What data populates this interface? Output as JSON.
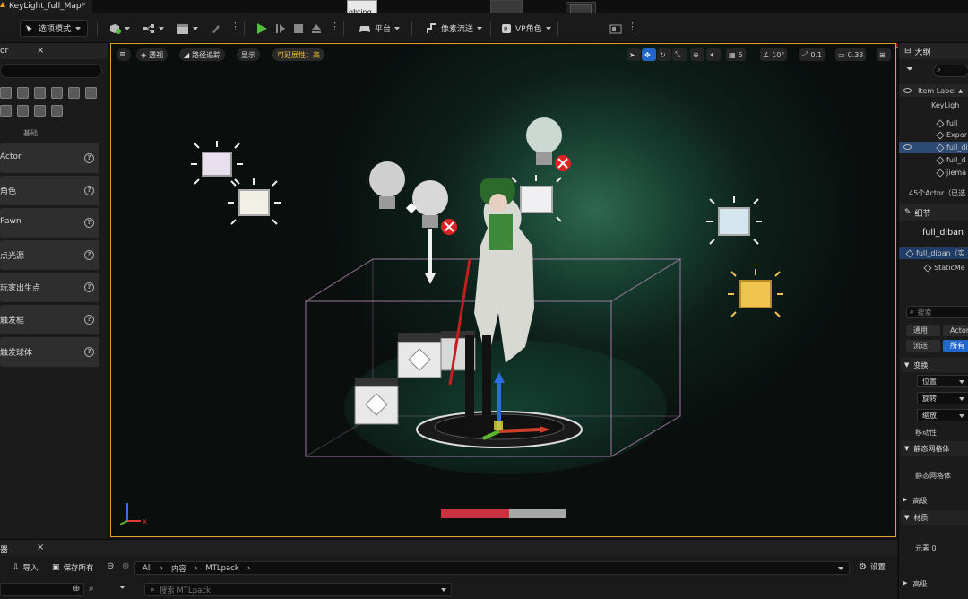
{
  "window": {
    "title": "KeyLight_full_Map*",
    "tab_partial": "ghting_"
  },
  "toolbar": {
    "mode_label": "选项模式",
    "platform_label": "平台",
    "pixel_stream_label": "像素流送",
    "vp_role_label": "VP角色"
  },
  "left_panel": {
    "title": "or",
    "category": "基础",
    "items": [
      {
        "label": "Actor"
      },
      {
        "label": "角色"
      },
      {
        "label": "Pawn"
      },
      {
        "label": "点光源"
      },
      {
        "label": "玩家出生点"
      },
      {
        "label": "触发框"
      },
      {
        "label": "触发球体"
      }
    ]
  },
  "viewport": {
    "perspective_label": "透视",
    "path_tracing_label": "路径追踪",
    "show_label": "显示",
    "scalability_label": "可延展性：高",
    "grid_snap": "5",
    "rot_snap": "10°",
    "scale_snap": "0.1",
    "camera_speed": "0.33",
    "progress": 0.55
  },
  "outliner": {
    "title": "大纲",
    "column_label": "Item Label",
    "rows": [
      {
        "label": "KeyLigh",
        "selected": false
      },
      {
        "label": "full",
        "selected": false
      },
      {
        "label": "Expor",
        "selected": false
      },
      {
        "label": "full_di",
        "selected": true
      },
      {
        "label": "full_d",
        "selected": false
      },
      {
        "label": "jiema",
        "selected": false
      }
    ],
    "actor_count": "45个Actor（已选"
  },
  "details": {
    "title": "细节",
    "object_name": "full_diban",
    "component_root": "full_diban（实",
    "component_child": "StaticMe",
    "search_placeholder": "搜索",
    "filters": [
      "通用",
      "Actor",
      "流送",
      "所有"
    ],
    "transform_section": "变换",
    "location_label": "位置",
    "rotation_label": "旋转",
    "scale_label": "缩放",
    "mobility_label": "移动性",
    "static_mesh_section": "静态网格体",
    "static_mesh_label": "静态网格体",
    "advanced_label": "高级",
    "materials_section": "材质",
    "element_label": "元素 0",
    "advanced_label_2": "高级"
  },
  "content_browser": {
    "title": "器",
    "import_label": "导入",
    "save_all_label": "保存所有",
    "path": [
      "All",
      "内容",
      "MTLpack"
    ],
    "settings_label": "设置",
    "search_placeholder": "搜索 MTLpack"
  },
  "colors": {
    "viewport_border": "#e0a02c",
    "selection_blue": "#2166c9",
    "play_green": "#4fbf3a",
    "progress_red": "#c9323e",
    "warning_yellow": "#f2c230"
  }
}
